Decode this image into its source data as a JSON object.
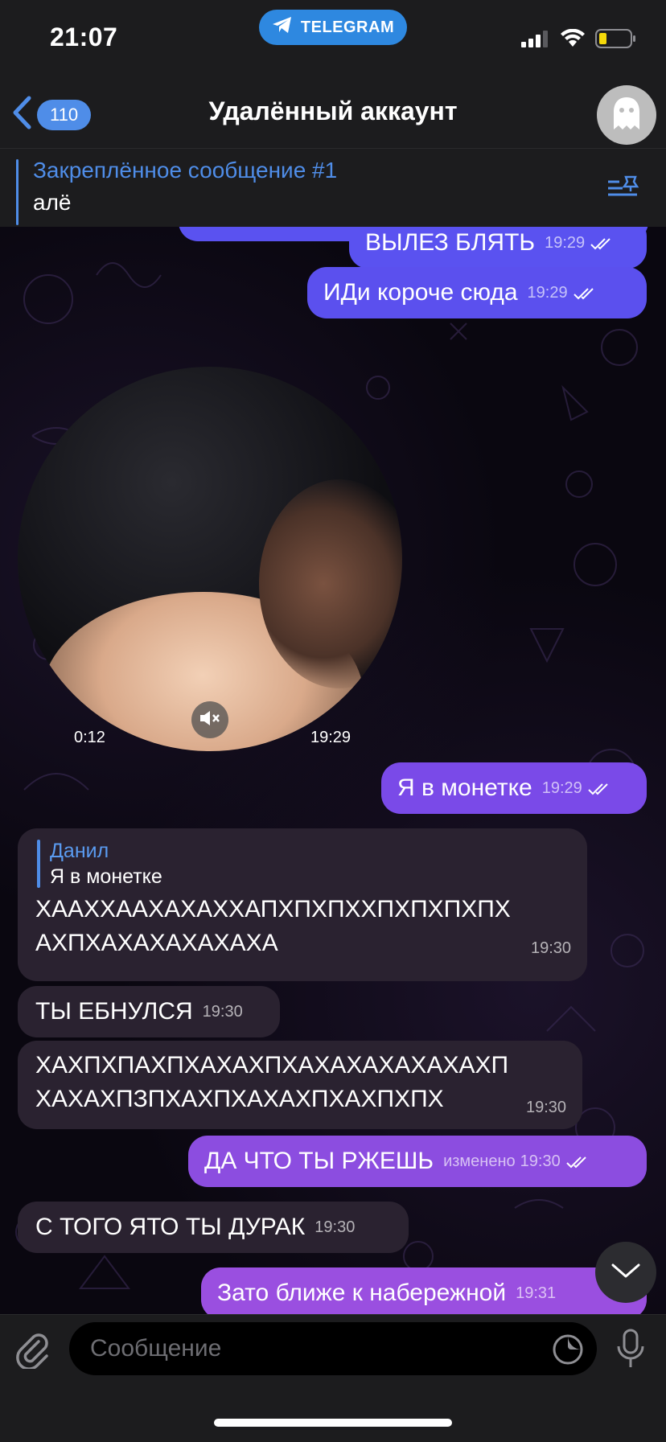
{
  "status": {
    "time": "21:07",
    "app_pill": "TELEGRAM"
  },
  "nav": {
    "back_count": "110",
    "title": "Удалённый аккаунт"
  },
  "pinned": {
    "title": "Закреплённое сообщение #1",
    "text": "алё"
  },
  "messages": {
    "m1": {
      "text": "ВЫЛЕЗ БЛЯТЬ",
      "time": "19:29"
    },
    "m2": {
      "text": "ИДи короче сюда",
      "time": "19:29"
    },
    "video": {
      "duration": "0:12",
      "time": "19:29"
    },
    "m3": {
      "text": "Я в монетке",
      "time": "19:29"
    },
    "m4": {
      "reply_author": "Данил",
      "reply_text": "Я в монетке",
      "line1": "ХААХХААХАХАХХАПХПХПХХПХПХПХПХ",
      "line2": "АХПХАХАХАХАХАХА",
      "time": "19:30"
    },
    "m5": {
      "text": "ТЫ ЕБНУЛСЯ",
      "time": "19:30"
    },
    "m6": {
      "line1": "ХАХПХПАХПХАХАХПХАХАХАХАХАХАХП",
      "line2": "ХАХАХПЗПХАХПХАХАХПХАХПХПХ",
      "time": "19:30"
    },
    "m7": {
      "text": "ДА ЧТО ТЫ РЖЕШЬ",
      "edited": "изменено",
      "time": "19:30"
    },
    "m8": {
      "text": "С ТОГО ЯТО ТЫ ДУРАК",
      "time": "19:30"
    },
    "m9": {
      "text": "Зато ближе к набережной",
      "time": "19:31"
    }
  },
  "input": {
    "placeholder": "Сообщение"
  },
  "colors": {
    "accent": "#4f8de8",
    "out_bubble_top": "#5a52f0",
    "out_bubble_bottom": "#9a4fe0",
    "in_bubble": "#2a2230"
  }
}
